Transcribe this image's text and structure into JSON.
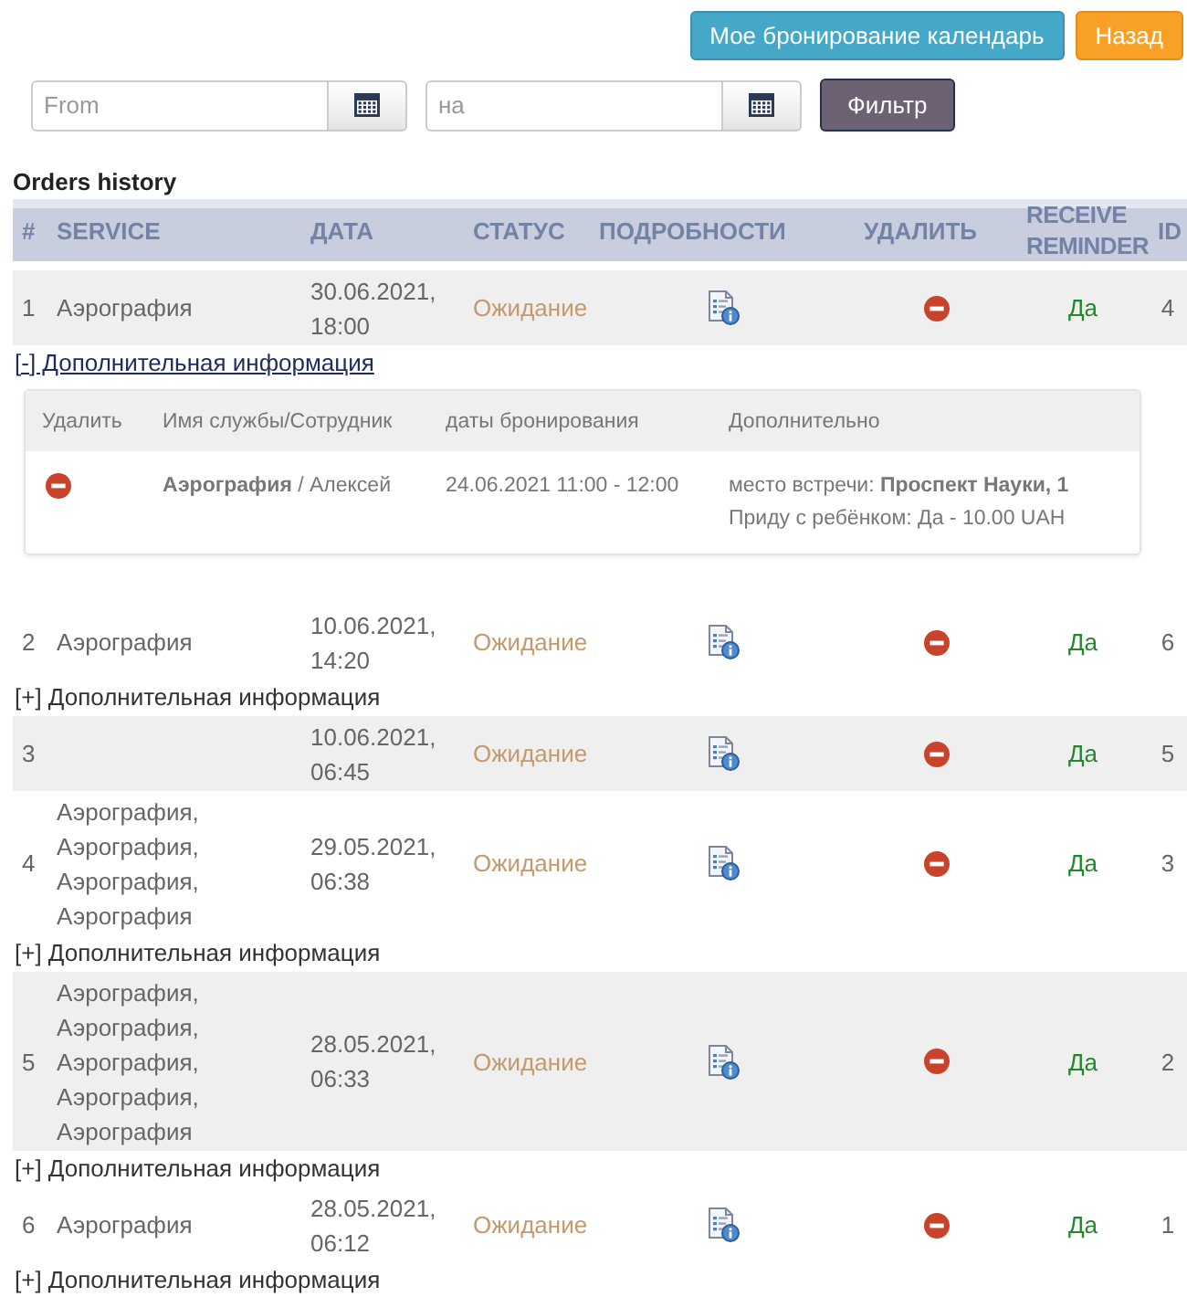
{
  "top_buttons": [
    {
      "label": "Мое бронирование календарь",
      "kind": "info"
    },
    {
      "label": "Назад",
      "kind": "warning"
    }
  ],
  "filter": {
    "from_field": {
      "placeholder": "From"
    },
    "to_field": {
      "placeholder": "на"
    },
    "button": "Фильтр"
  },
  "orders_history": {
    "title": "Orders history",
    "columns": [
      "#",
      "SERVICE",
      "ДАТА",
      "СТАТУС",
      "ПОДРОБНОСТИ",
      "УДАЛИТЬ",
      "RECEIVE REMINDER",
      "ID"
    ],
    "rows": [
      {
        "number": "1",
        "service": "Аэрография",
        "date": "30.06.2021, 18:00",
        "status": "Ожидание",
        "reminder": "Да",
        "id": "4",
        "more_info": {
          "label": "[-] Дополнительная информация",
          "expanded": true,
          "columns": [
            "Удалить",
            "Имя службы/Сотрудник",
            "даты бронирования",
            "Дополнительно"
          ],
          "items": [
            {
              "service": "**Аэрография** / Алексей",
              "dates": "24.06.2021 11:00 - 12:00",
              "extra": [
                "место встречи: **Проспект Науки, 1**",
                "Приду с ребёнком: Да - 10.00 UAH"
              ]
            }
          ]
        }
      },
      {
        "number": "2",
        "service": "Аэрография",
        "date": "10.06.2021, 14:20",
        "status": "Ожидание",
        "reminder": "Да",
        "id": "6",
        "more_info": {
          "label": "[+] Дополнительная информация",
          "expanded": false
        }
      },
      {
        "number": "3",
        "date": "10.06.2021, 06:45",
        "status": "Ожидание",
        "reminder": "Да",
        "id": "5"
      },
      {
        "number": "4",
        "service": "Аэрография, Аэрография, Аэрография, Аэрография",
        "date": "29.05.2021, 06:38",
        "status": "Ожидание",
        "reminder": "Да",
        "id": "3",
        "more_info": {
          "label": "[+] Дополнительная информация",
          "expanded": false
        }
      },
      {
        "number": "5",
        "service": "Аэрография, Аэрография, Аэрография, Аэрография, Аэрография",
        "date": "28.05.2021, 06:33",
        "status": "Ожидание",
        "reminder": "Да",
        "id": "2",
        "more_info": {
          "label": "[+] Дополнительная информация",
          "expanded": false
        }
      },
      {
        "number": "6",
        "service": "Аэрография",
        "date": "28.05.2021, 06:12",
        "status": "Ожидание",
        "reminder": "Да",
        "id": "1",
        "more_info": {
          "label": "[+] Дополнительная информация",
          "expanded": false
        }
      }
    ]
  }
}
